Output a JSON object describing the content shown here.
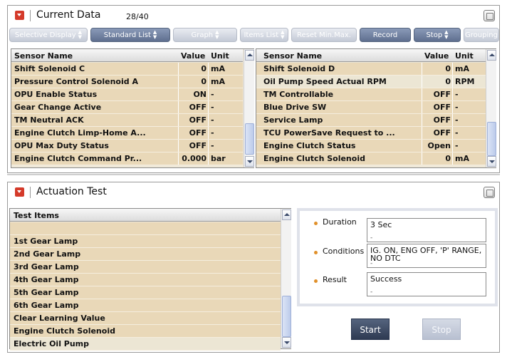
{
  "current_data": {
    "title": "Current Data",
    "count": "28/40",
    "toolbar": [
      {
        "label": "Selective Display",
        "state": "disabled",
        "arrows": true
      },
      {
        "label": "Standard List",
        "state": "active",
        "arrows": true
      },
      {
        "label": "Graph",
        "state": "disabled",
        "arrows": true
      },
      {
        "label": "Items List",
        "state": "disabled",
        "arrows": true
      },
      {
        "label": "Reset Min.Max.",
        "state": "disabled",
        "arrows": false
      },
      {
        "label": "Record",
        "state": "active",
        "arrows": false
      },
      {
        "label": "Stop",
        "state": "active",
        "arrows": true
      },
      {
        "label": "Grouping",
        "state": "disabled",
        "arrows": false
      }
    ],
    "columns": {
      "name": "Sensor Name",
      "value": "Value",
      "unit": "Unit"
    },
    "left_rows": [
      {
        "name": "Shift Solenoid C",
        "value": "0",
        "unit": "mA"
      },
      {
        "name": "Pressure Control Solenoid A",
        "value": "0",
        "unit": "mA"
      },
      {
        "name": "OPU Enable Status",
        "value": "ON",
        "unit": "-"
      },
      {
        "name": "Gear Change Active",
        "value": "OFF",
        "unit": "-"
      },
      {
        "name": "TM Neutral ACK",
        "value": "OFF",
        "unit": "-"
      },
      {
        "name": "Engine Clutch Limp-Home A...",
        "value": "OFF",
        "unit": "-"
      },
      {
        "name": "OPU Max Duty Status",
        "value": "OFF",
        "unit": "-"
      },
      {
        "name": "Engine Clutch Command Pr...",
        "value": "0.000",
        "unit": "bar"
      }
    ],
    "right_rows": [
      {
        "name": "Shift Solenoid D",
        "value": "0",
        "unit": "mA"
      },
      {
        "name": "Oil Pump Speed Actual RPM",
        "value": "0",
        "unit": "RPM"
      },
      {
        "name": "TM Controllable",
        "value": "OFF",
        "unit": "-"
      },
      {
        "name": "Blue Drive SW",
        "value": "OFF",
        "unit": "-"
      },
      {
        "name": "Service Lamp",
        "value": "OFF",
        "unit": "-"
      },
      {
        "name": "TCU PowerSave Request to ...",
        "value": "OFF",
        "unit": "-"
      },
      {
        "name": "Engine Clutch Status",
        "value": "Open",
        "unit": "-"
      },
      {
        "name": "Engine Clutch Solenoid",
        "value": "0",
        "unit": "mA"
      }
    ]
  },
  "actuation_test": {
    "title": "Actuation Test",
    "list_header": "Test Items",
    "items": [
      "1st Gear Lamp",
      "2nd Gear Lamp",
      "3rd Gear Lamp",
      "4th Gear Lamp",
      "5th Gear Lamp",
      "6th Gear Lamp",
      "Clear Learning Value",
      "Engine Clutch Solenoid",
      "Electric Oil Pump"
    ],
    "selected_item": "Electric Oil Pump",
    "duration_label": "Duration",
    "duration_value": "3 Sec",
    "conditions_label": "Conditions",
    "conditions_value": "IG. ON, ENG OFF, 'P' RANGE, NO DTC",
    "result_label": "Result",
    "result_value": "Success",
    "start_label": "Start",
    "stop_label": "Stop"
  },
  "colors": {
    "row_bg": "#e9d8b8",
    "selected_row_bg": "#ece6d4",
    "active_button": "#6b7a98",
    "disabled_button": "#d3d8e2",
    "start_button": "#3a4660",
    "accent_red": "#d43a2a",
    "bullet_orange": "#e0902a"
  }
}
